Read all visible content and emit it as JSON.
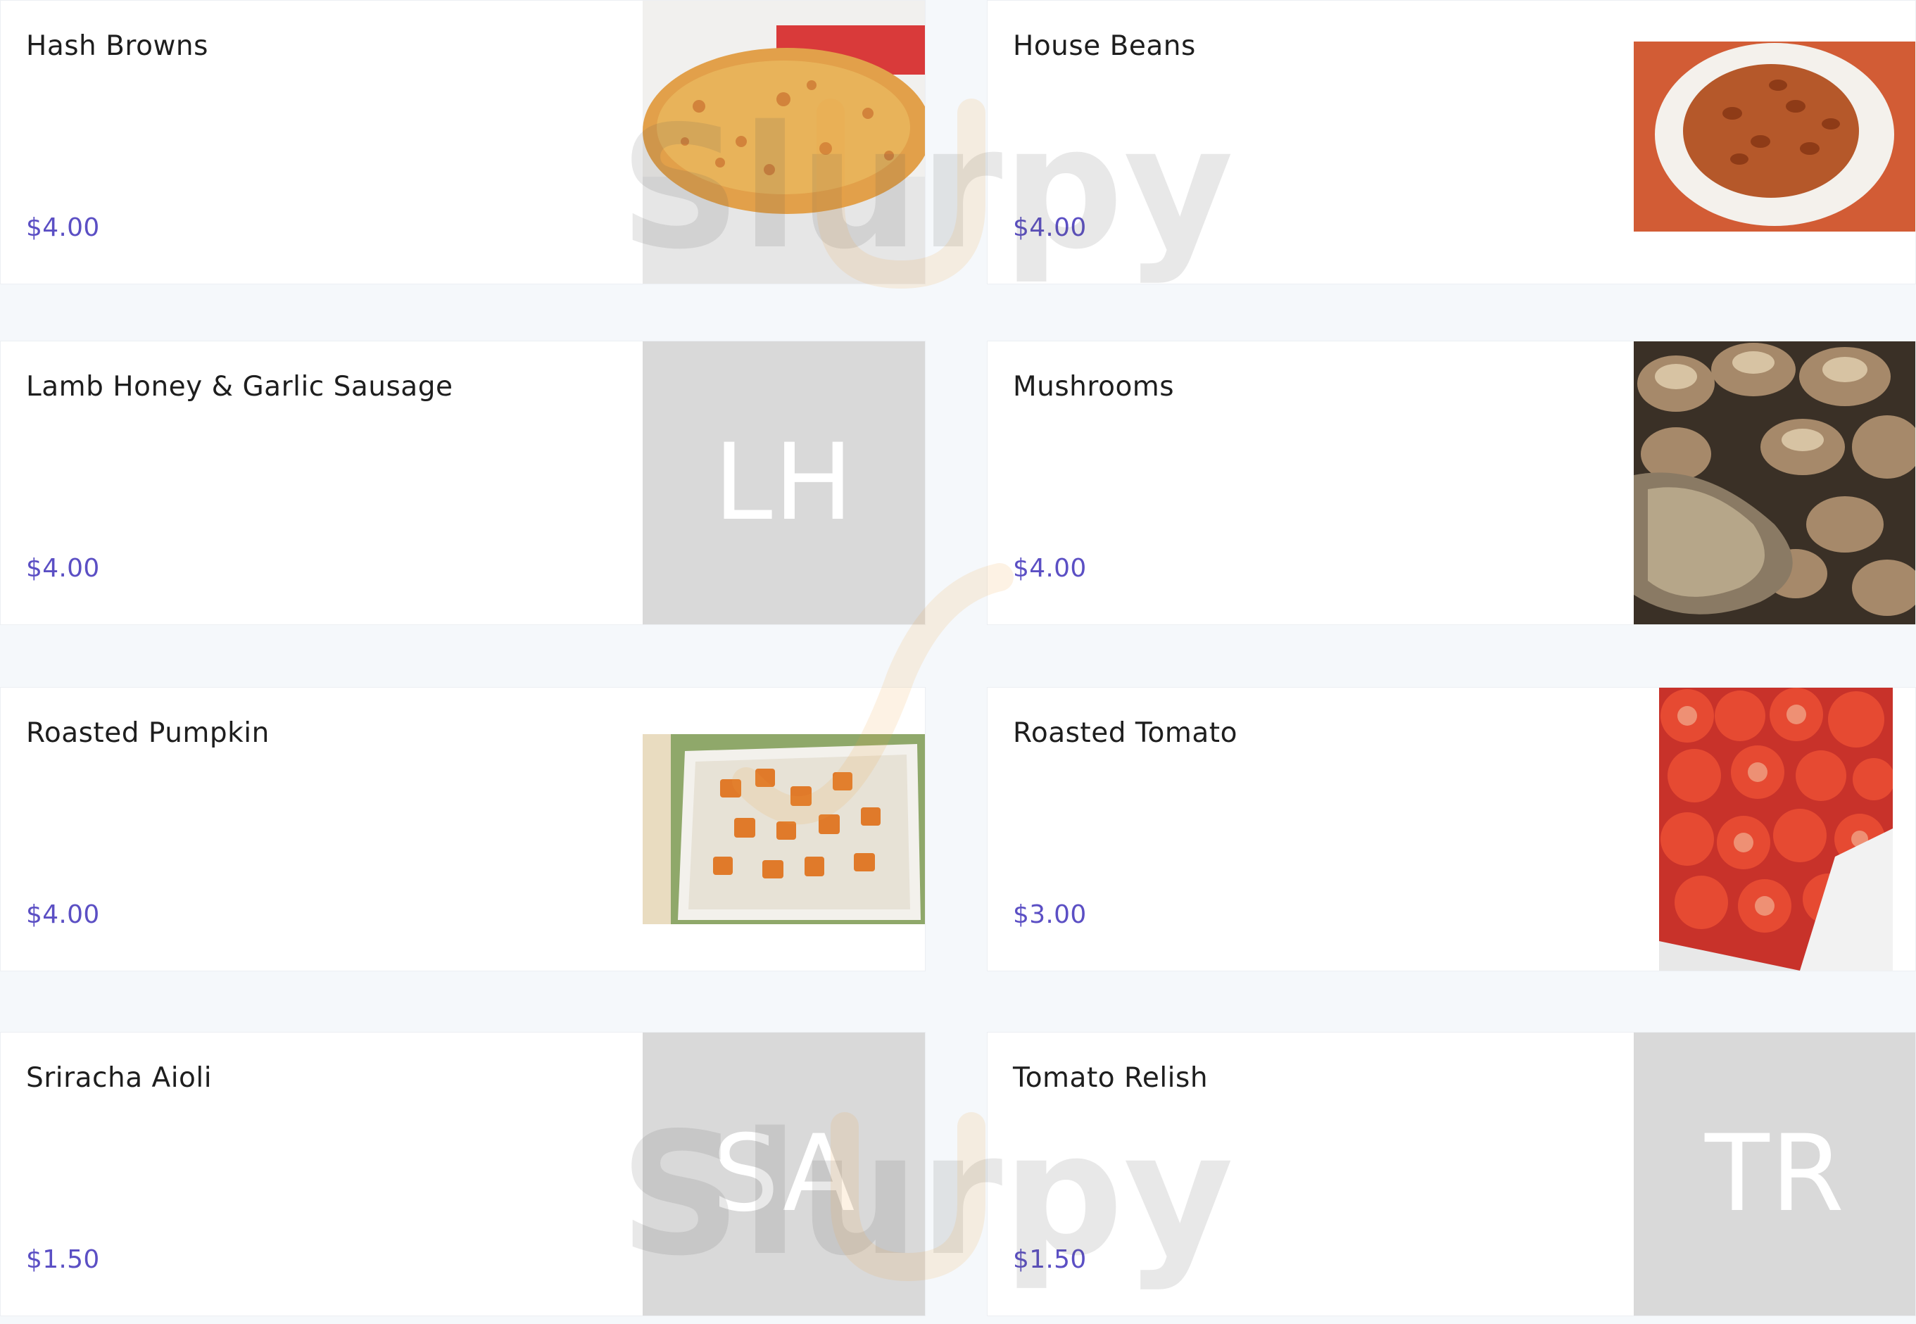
{
  "menu": {
    "items": [
      {
        "name": "Hash Browns",
        "price": "$4.00",
        "image": "hash-browns-photo"
      },
      {
        "name": "House Beans",
        "price": "$4.00",
        "image": "house-beans-photo"
      },
      {
        "name": "Lamb Honey & Garlic Sausage",
        "price": "$4.00",
        "image": "placeholder",
        "initials": "LH"
      },
      {
        "name": "Mushrooms",
        "price": "$4.00",
        "image": "mushrooms-photo"
      },
      {
        "name": "Roasted Pumpkin",
        "price": "$4.00",
        "image": "roasted-pumpkin-photo"
      },
      {
        "name": "Roasted Tomato",
        "price": "$3.00",
        "image": "roasted-tomato-photo"
      },
      {
        "name": "Sriracha Aioli",
        "price": "$1.50",
        "image": "placeholder",
        "initials": "SA"
      },
      {
        "name": "Tomato Relish",
        "price": "$1.50",
        "image": "placeholder",
        "initials": "TR"
      }
    ]
  },
  "watermark": {
    "text": "Slurpy"
  },
  "colors": {
    "price": "#5b4fc4",
    "page_background": "#f5f8fb",
    "placeholder": "#d9d9d9",
    "watermark_orange": "#f0a040"
  }
}
